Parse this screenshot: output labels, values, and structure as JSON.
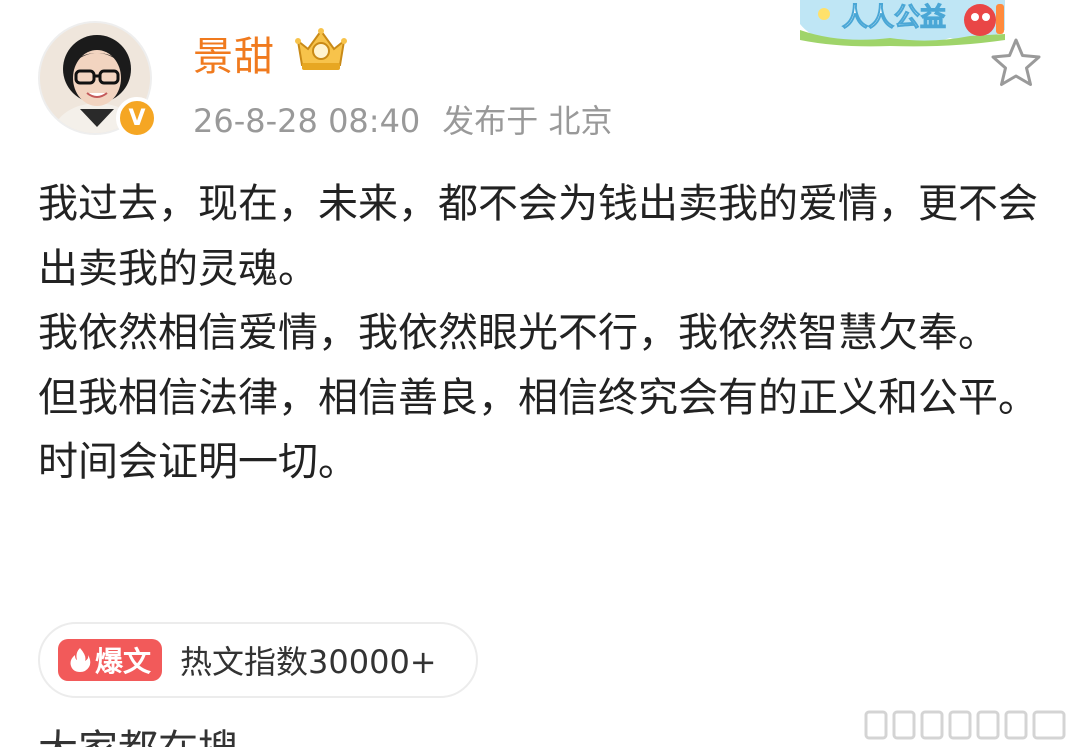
{
  "post": {
    "author": "景甜",
    "datetime": "26-8-28 08:40",
    "location": "发布于 北京",
    "content_lines": [
      "我过去，现在，未来，都不会为钱出卖我的爱情，更不会出卖我的灵魂。",
      "我依然相信爱情，我依然眼光不行，我依然智慧欠奉。",
      "但我相信法律，相信善良，相信终究会有的正义和公平。",
      "时间会证明一切。"
    ],
    "hot_badge_label": "爆文",
    "hot_index_text": "热文指数30000+",
    "cut_off_text": "大家都在搜"
  },
  "banner": {
    "label": "人人公益"
  },
  "icons": {
    "verified": "verified-v-icon",
    "crown": "crown-icon",
    "star": "star-outline-icon",
    "fire": "fire-icon"
  },
  "colors": {
    "username": "#f07a1e",
    "meta": "#999999",
    "hot_badge": "#f25a5a",
    "verified": "#f5a623"
  }
}
